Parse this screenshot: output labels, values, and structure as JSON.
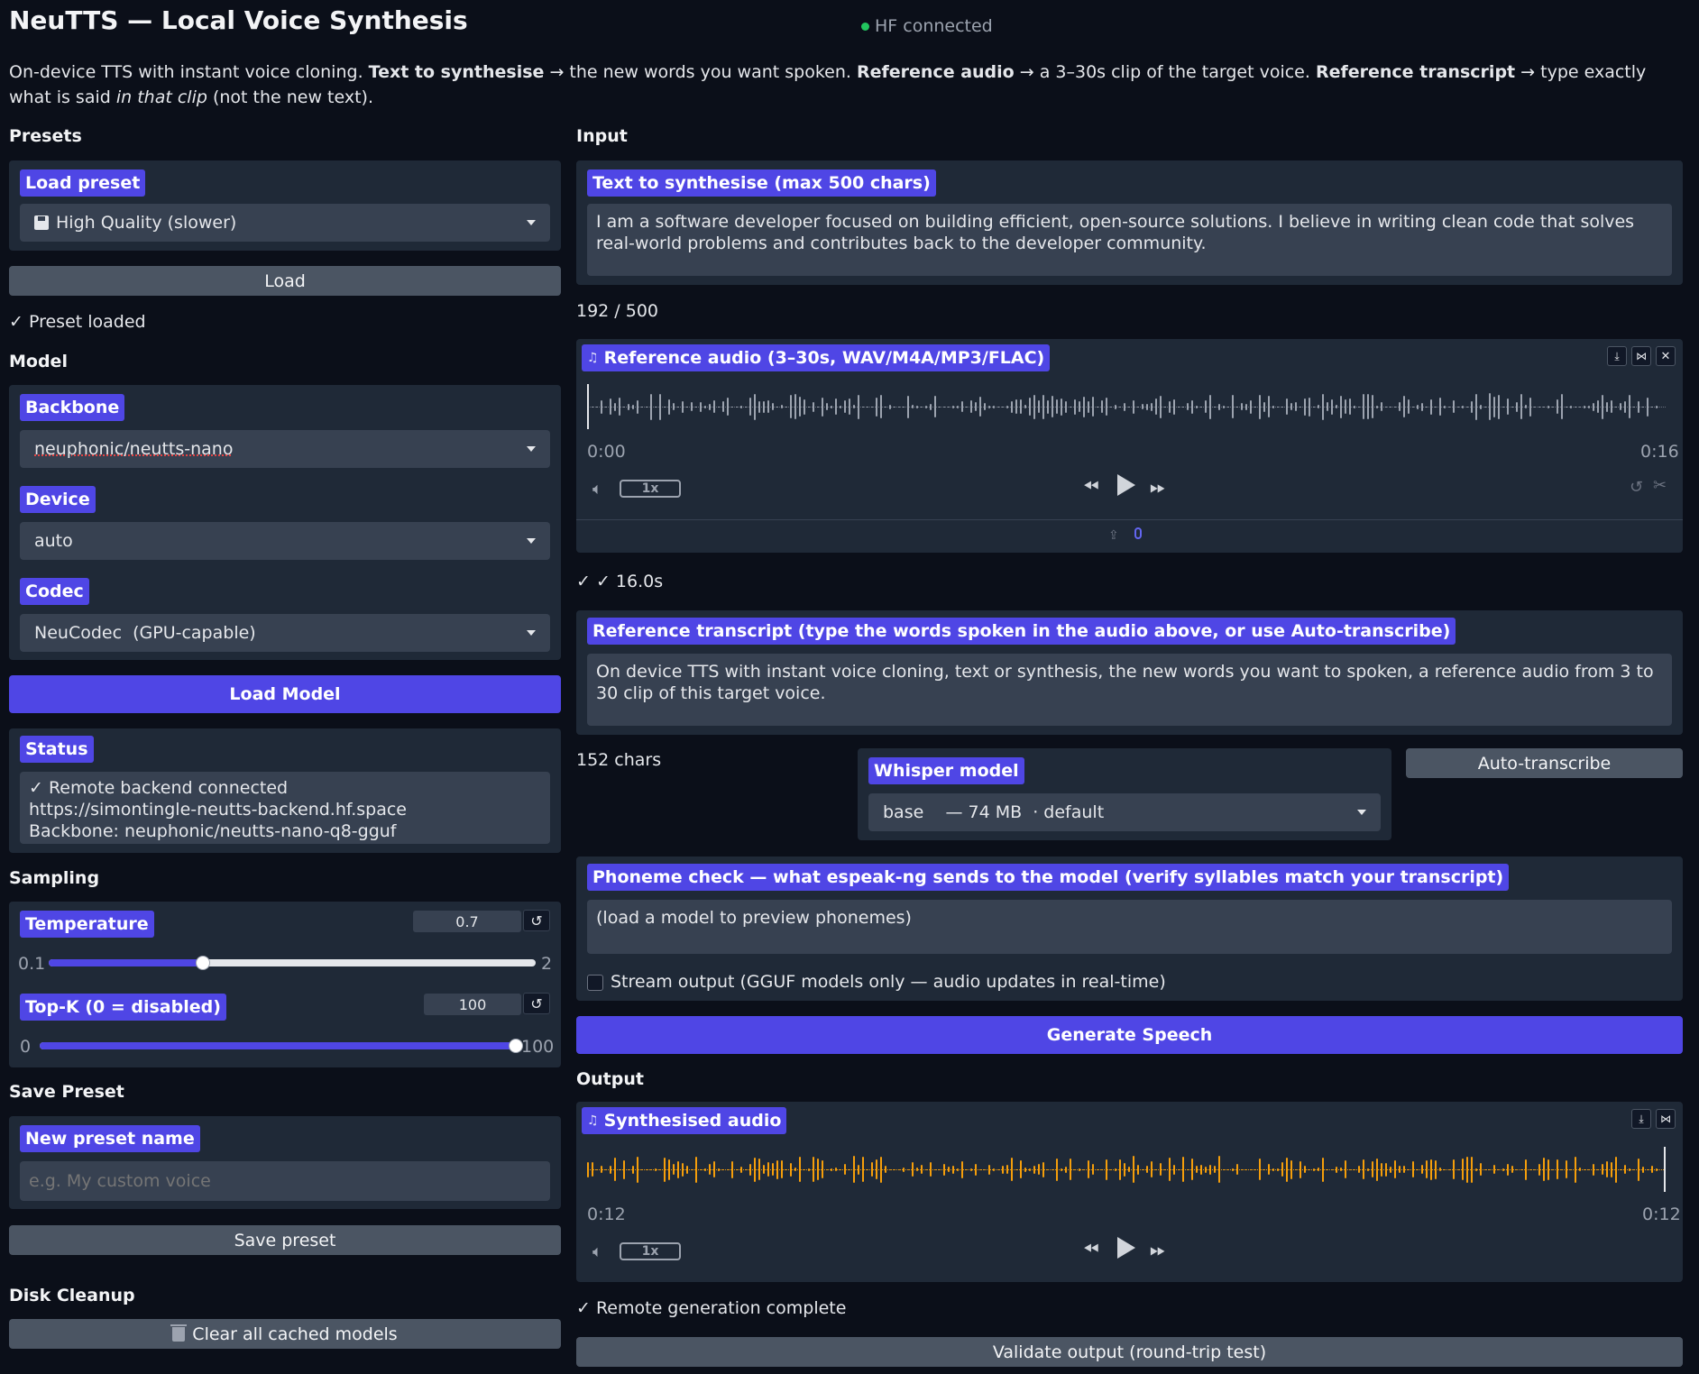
{
  "header": {
    "title": "NeuTTS — Local Voice Synthesis",
    "hf_status": "HF connected"
  },
  "intro": {
    "p1": "On-device TTS with instant voice cloning. ",
    "b1": "Text to synthesise",
    "p2": " → the new words you want spoken. ",
    "b2": "Reference audio",
    "p3": " → a 3–30s clip of the target voice. ",
    "b3": "Reference transcript",
    "p4": " → type exactly what is said ",
    "i1": "in that clip",
    "p5": " (not the new text)."
  },
  "presets": {
    "section": "Presets",
    "label": "Load preset",
    "value": "High Quality (slower)",
    "load_button": "Load",
    "status": "✓ Preset loaded"
  },
  "model": {
    "section": "Model",
    "backbone_label": "Backbone",
    "backbone_value": "neuphonic/neutts-nano",
    "device_label": "Device",
    "device_value": "auto",
    "codec_label": "Codec",
    "codec_value": "NeuCodec  (GPU-capable)",
    "load_button": "Load Model",
    "status_label": "Status",
    "status_line1": "✓ Remote backend connected",
    "status_line2": "https://simontingle-neutts-backend.hf.space",
    "status_line3": "Backbone: neuphonic/neutts-nano-q8-gguf"
  },
  "sampling": {
    "section": "Sampling",
    "temperature_label": "Temperature",
    "temperature_value": "0.7",
    "temperature_min": "0.1",
    "temperature_max": "2",
    "temperature_fraction": 0.316,
    "topk_label": "Top-K (0 = disabled)",
    "topk_value": "100",
    "topk_min": "0",
    "topk_max": "100",
    "topk_fraction": 1.0
  },
  "save_preset": {
    "section": "Save Preset",
    "label": "New preset name",
    "placeholder": "e.g. My custom voice",
    "button": "Save preset"
  },
  "disk": {
    "section": "Disk Cleanup",
    "button": "Clear all cached models"
  },
  "input": {
    "section": "Input",
    "text_label": "Text to synthesise (max 500 chars)",
    "text_value": "I am a software developer focused on building efficient, open-source solutions. I believe in writing clean code that solves real-world problems and contributes back to the developer community.",
    "char_count": "192 / 500",
    "ref_audio_label": "Reference audio (3–30s, WAV/M4A/MP3/FLAC)",
    "ref_time_start": "0:00",
    "ref_time_end": "0:16",
    "ref_speed": "1x",
    "ref_status": "✓ ✓ 16.0s",
    "transcript_label": "Reference transcript (type the words spoken in the audio above, or use Auto-transcribe)",
    "transcript_value": "On device TTS with instant voice cloning, text or synthesis, the new words you want to spoken, a reference audio from 3 to 30 clip of this target voice.",
    "transcript_count": "152 chars",
    "whisper_label": "Whisper model",
    "whisper_value": "base    — 74 MB  · default",
    "autotranscribe_button": "Auto-transcribe",
    "phoneme_label": "Phoneme check — what espeak-ng sends to the model (verify syllables match your transcript)",
    "phoneme_value": "(load a model to preview phonemes)",
    "stream_label": "Stream output (GGUF models only — audio updates in real-time)",
    "generate_button": "Generate Speech"
  },
  "output": {
    "section": "Output",
    "audio_label": "Synthesised audio",
    "time_start": "0:12",
    "time_end": "0:12",
    "speed": "1x",
    "status": "✓ Remote generation complete",
    "validate_button": "Validate output (round-trip test)"
  },
  "colors": {
    "accent": "#4f46e5",
    "ref_wave": "#9ca3af",
    "out_wave": "#f59e0b",
    "background": "#0b0f19",
    "panel": "#1f2937"
  }
}
